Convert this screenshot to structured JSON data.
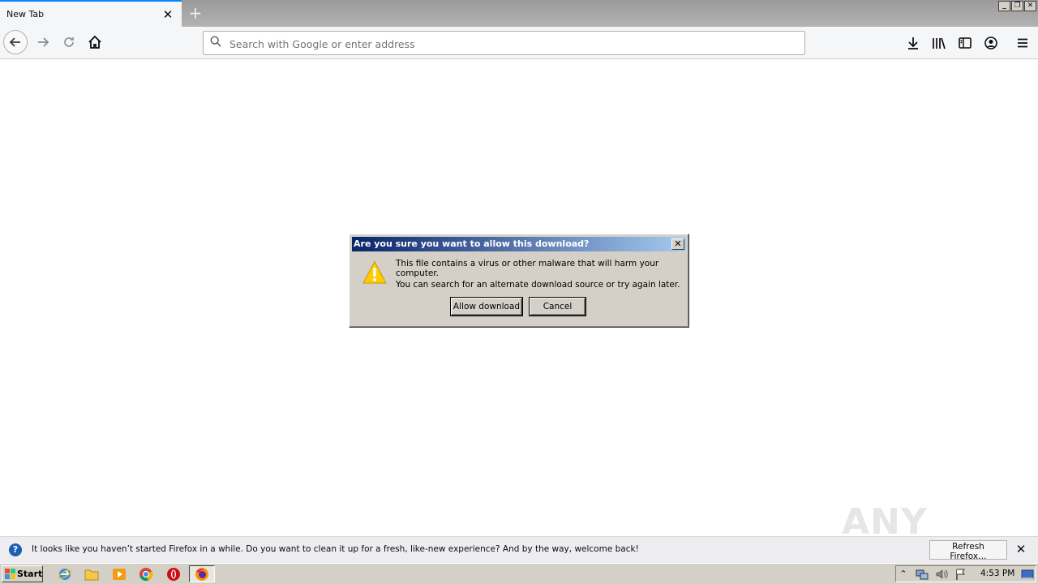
{
  "browser": {
    "tab_title": "New Tab",
    "address_placeholder": "Search with Google or enter address"
  },
  "dialog": {
    "title": "Are you sure you want to allow this download?",
    "line1": "This file contains a virus or other malware that will harm your computer.",
    "line2": "You can search for an alternate download source or try again later.",
    "allow_label": "Allow download",
    "cancel_label": "Cancel"
  },
  "notification": {
    "message": "It looks like you haven’t started Firefox in a while. Do you want to clean it up for a fresh, like-new experience? And by the way, welcome back!",
    "refresh_label": "Refresh Firefox…"
  },
  "watermark": {
    "text": "ANY RUN"
  },
  "taskbar": {
    "start_label": "Start",
    "clock": "4:53 PM",
    "quick_launch": [
      "ie-icon",
      "folder-icon",
      "media-player-icon",
      "chrome-icon",
      "opera-icon"
    ],
    "active_task": "firefox-icon"
  },
  "colors": {
    "dialog_title_start": "#0a246a",
    "dialog_title_end": "#a6caf0",
    "warning": "#ffcc00",
    "accent": "#0a84ff"
  }
}
